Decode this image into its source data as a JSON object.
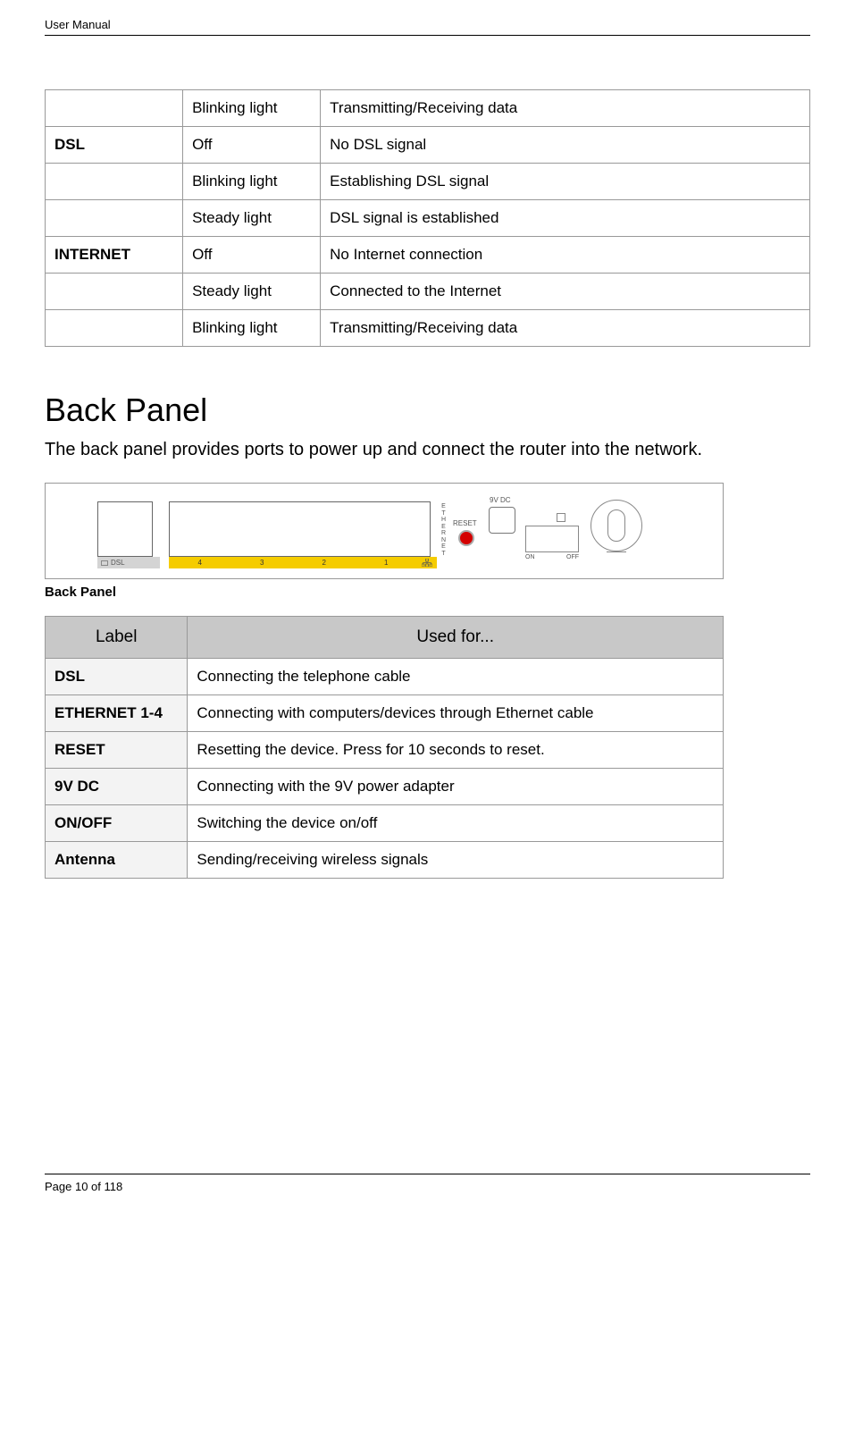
{
  "header": {
    "title": "User Manual"
  },
  "led_table": {
    "rows": [
      {
        "label": "",
        "state": "Blinking light",
        "meaning": "Transmitting/Receiving data"
      },
      {
        "label": "DSL",
        "state": "Off",
        "meaning": "No DSL signal"
      },
      {
        "label": "",
        "state": "Blinking light",
        "meaning": "Establishing DSL signal"
      },
      {
        "label": "",
        "state": "Steady light",
        "meaning": "DSL signal is established"
      },
      {
        "label": "INTERNET",
        "state": "Off",
        "meaning": "No Internet connection"
      },
      {
        "label": "",
        "state": "Steady light",
        "meaning": "Connected to the Internet"
      },
      {
        "label": "",
        "state": "Blinking light",
        "meaning": "Transmitting/Receiving data"
      }
    ]
  },
  "section": {
    "heading": "Back Panel",
    "description": "The back panel provides ports to power up and connect the router into the network."
  },
  "diagram": {
    "dsl_label": "DSL",
    "eth_labels": [
      "4",
      "3",
      "2",
      "1"
    ],
    "ethernet_vtext": "ETHERNET",
    "reset_label": "RESET",
    "dc_label": "9V DC",
    "on_label": "ON",
    "off_label": "OFF"
  },
  "caption": "Back Panel",
  "bp_table": {
    "headers": {
      "col1": "Label",
      "col2": "Used for..."
    },
    "rows": [
      {
        "label": "DSL",
        "use": "Connecting the telephone cable"
      },
      {
        "label": "ETHERNET 1-4",
        "use": "Connecting with computers/devices through Ethernet cable"
      },
      {
        "label": "RESET",
        "use": "Resetting the device. Press for 10 seconds to reset."
      },
      {
        "label": "9V DC",
        "use": "Connecting with the 9V power adapter"
      },
      {
        "label": "ON/OFF",
        "use": "Switching the device on/off"
      },
      {
        "label": "Antenna",
        "use": "Sending/receiving wireless signals"
      }
    ]
  },
  "footer": {
    "page": "Page 10 of 118"
  }
}
